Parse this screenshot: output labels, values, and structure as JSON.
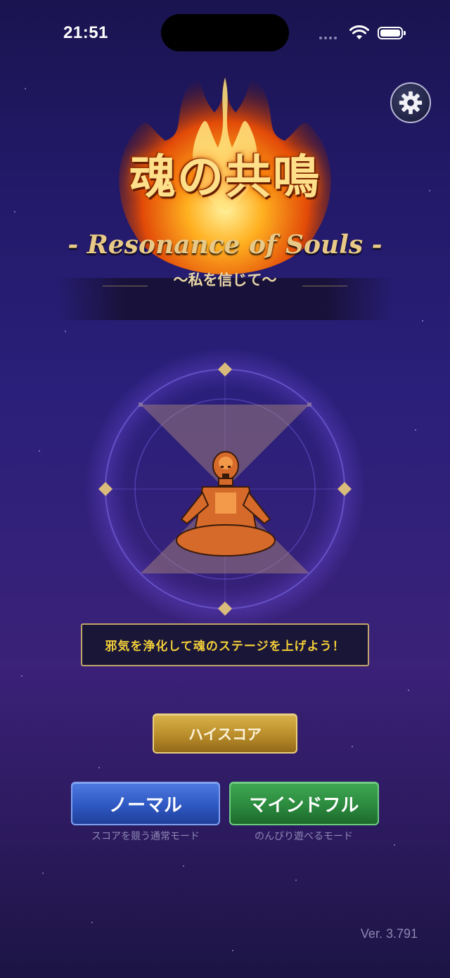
{
  "status_bar": {
    "time": "21:51"
  },
  "logo": {
    "title_jp": "魂の共鳴",
    "title_en": "- Resonance of Souls -",
    "subtitle": "〜私を信じて〜"
  },
  "message": "邪気を浄化して魂のステージを上げよう！",
  "buttons": {
    "highscore": "ハイスコア",
    "normal": "ノーマル",
    "mindful": "マインドフル"
  },
  "captions": {
    "normal": "スコアを競う通常モード",
    "mindful": "のんびり遊べるモード"
  },
  "version": "Ver. 3.791",
  "icons": {
    "settings": "gear-icon",
    "wifi": "wifi-icon",
    "battery": "battery-icon",
    "signal": "cellular-signal-icon"
  },
  "colors": {
    "background_top": "#1a1450",
    "background_mid": "#2a1f7a",
    "message_text": "#f3cf38",
    "gold": "#bfa56a",
    "normal_button": "#2f58c2",
    "mindful_button": "#2b8a3e",
    "highscore_button": "#b98d2a"
  }
}
